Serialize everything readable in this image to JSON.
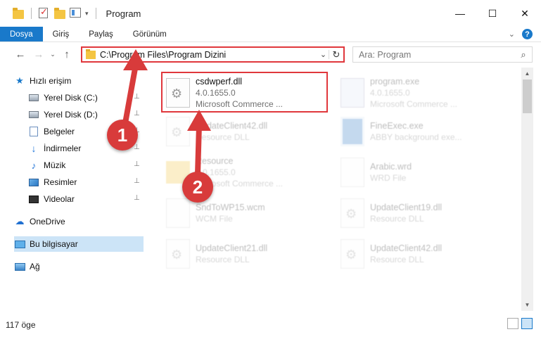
{
  "window": {
    "title": "Program",
    "minimize": "—",
    "maximize": "☐",
    "close": "✕"
  },
  "ribbon": {
    "tabs": [
      "Dosya",
      "Giriş",
      "Paylaş",
      "Görünüm"
    ],
    "help": "?"
  },
  "nav": {
    "back": "←",
    "forward": "→",
    "recent": "⌄",
    "up": "↑",
    "address": "C:\\Program Files\\Program Dizini",
    "dropdown": "⌄",
    "refresh": "↻",
    "search_placeholder": "Ara: Program",
    "search_icon": "⌕"
  },
  "sidebar": {
    "items": [
      {
        "label": "Hızlı erişim",
        "icon": "star-icon"
      },
      {
        "label": "Yerel Disk (C:)",
        "icon": "disk-icon"
      },
      {
        "label": "Yerel Disk (D:)",
        "icon": "disk-icon"
      },
      {
        "label": "Belgeler",
        "icon": "documents-icon"
      },
      {
        "label": "İndirmeler",
        "icon": "download-icon"
      },
      {
        "label": "Müzik",
        "icon": "music-icon"
      },
      {
        "label": "Resimler",
        "icon": "pictures-icon"
      },
      {
        "label": "Videolar",
        "icon": "video-icon"
      },
      {
        "label": "OneDrive",
        "icon": "cloud-icon"
      },
      {
        "label": "Bu bilgisayar",
        "icon": "computer-icon"
      },
      {
        "label": "Ağ",
        "icon": "network-icon"
      }
    ],
    "pin": "📌",
    "expand": "›"
  },
  "files": [
    {
      "name": "csdwperf.dll",
      "line1": "4.0.1655.0",
      "line2": "Microsoft Commerce ...",
      "type": "dll"
    },
    {
      "name": "program.exe",
      "line1": "4.0.1655.0",
      "line2": "Microsoft Commerce ...",
      "type": "exe"
    },
    {
      "name": "UpdateClient42.dll",
      "line1": "Resource DLL",
      "line2": "",
      "type": "dll"
    },
    {
      "name": "FineExec.exe",
      "line1": "ABBY background exe...",
      "line2": "",
      "type": "exe2"
    },
    {
      "name": "Resource",
      "line1": "4.0.1655.0",
      "line2": "Microsoft Commerce ...",
      "type": "folder"
    },
    {
      "name": "Arabic.wrd",
      "line1": "WRD File",
      "line2": "",
      "type": "doc"
    },
    {
      "name": "SndToWP15.wcm",
      "line1": "WCM File",
      "line2": "",
      "type": "doc"
    },
    {
      "name": "UpdateClient19.dll",
      "line1": "Resource DLL",
      "line2": "",
      "type": "dll"
    },
    {
      "name": "UpdateClient21.dll",
      "line1": "Resource DLL",
      "line2": "",
      "type": "dll"
    },
    {
      "name": "UpdateClient42.dll",
      "line1": "Resource DLL",
      "line2": "",
      "type": "dll"
    }
  ],
  "status": {
    "count": "117 öge"
  },
  "annotations": {
    "step1": "1",
    "step2": "2",
    "color": "#d83b3b",
    "highlight_color": "#e0373c"
  }
}
